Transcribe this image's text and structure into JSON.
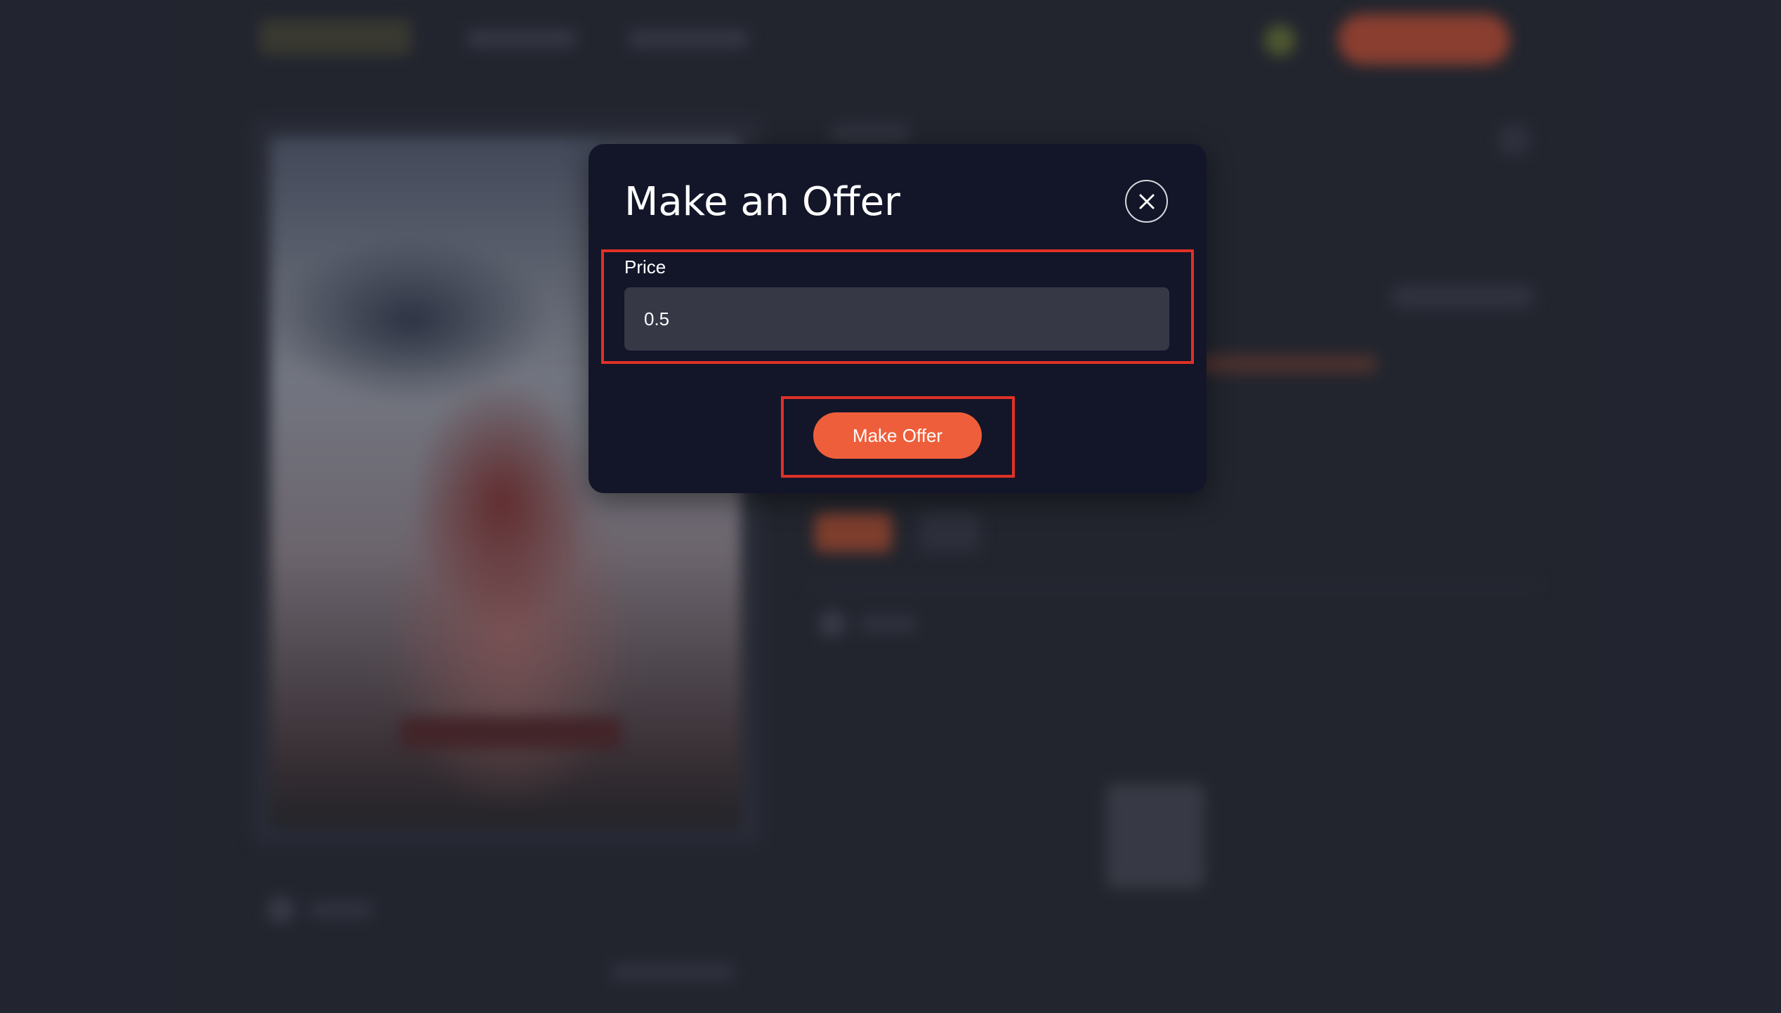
{
  "modal": {
    "title": "Make an Offer",
    "close_icon": "close-icon",
    "price": {
      "label": "Price",
      "value": "0.5"
    },
    "submit_label": "Make Offer"
  },
  "colors": {
    "accent": "#ef5e3b",
    "modal_bg": "#131629",
    "input_bg": "#363846",
    "highlight": "#e03127"
  }
}
